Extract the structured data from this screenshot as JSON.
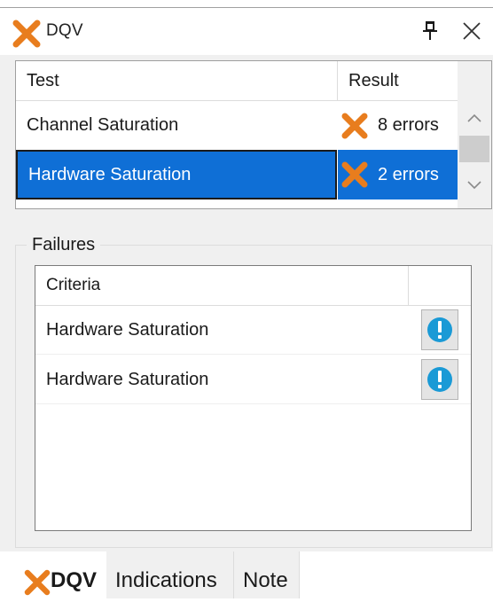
{
  "window": {
    "title": "DQV",
    "icons": {
      "title": "x-mark-icon",
      "pin": "pin-icon",
      "close": "close-icon"
    }
  },
  "tests": {
    "columns": {
      "test": "Test",
      "result": "Result"
    },
    "rows": [
      {
        "test": "Channel Saturation",
        "result": "8 errors",
        "status_icon": "error-x-icon",
        "selected": false
      },
      {
        "test": "Hardware Saturation",
        "result": "2 errors",
        "status_icon": "error-x-icon",
        "selected": true
      }
    ]
  },
  "failures": {
    "group_label": "Failures",
    "columns": {
      "criteria": "Criteria",
      "action": ""
    },
    "rows": [
      {
        "criteria": "Hardware Saturation",
        "action_icon": "info-icon"
      },
      {
        "criteria": "Hardware Saturation",
        "action_icon": "info-icon"
      }
    ]
  },
  "tabs": [
    {
      "label": "DQV",
      "active": true,
      "icon": "x-mark-icon"
    },
    {
      "label": "Indications",
      "active": false
    },
    {
      "label": "Note",
      "active": false
    }
  ],
  "colors": {
    "accent_orange": "#e87d1e",
    "selection_blue": "#0f6fd6",
    "info_blue": "#1a9ad6",
    "panel_bg": "#f0f0f0"
  }
}
